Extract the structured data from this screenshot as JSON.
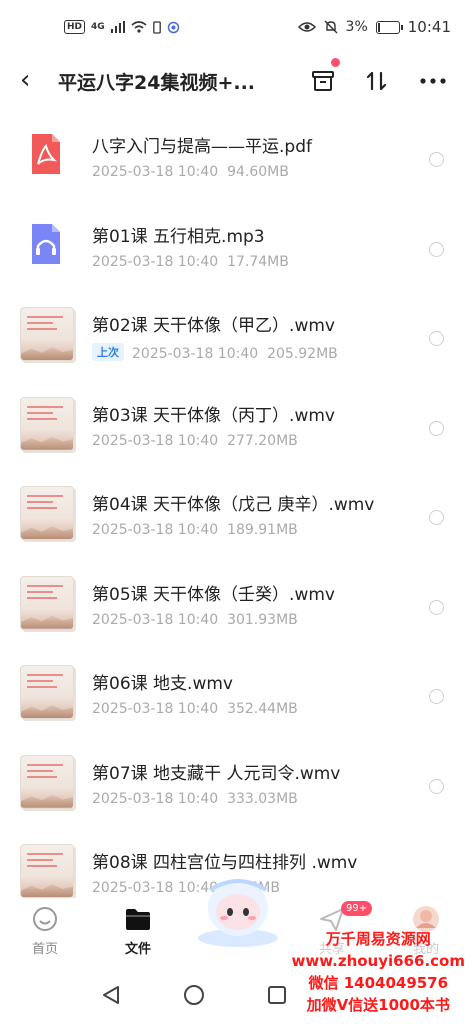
{
  "status_bar": {
    "hd": "HD",
    "network": "4G",
    "battery": "3%",
    "time": "10:41"
  },
  "header": {
    "title": "平运八字24集视频+...",
    "back_icon": "chevron-left-icon",
    "icons": [
      "archive-box-icon",
      "sort-icon",
      "more-icon"
    ]
  },
  "files": [
    {
      "name": "八字入门与提高——平运.pdf",
      "date": "2025-03-18  10:40",
      "size": "94.60MB",
      "type": "pdf",
      "badge": ""
    },
    {
      "name": "第01课  五行相克.mp3",
      "date": "2025-03-18  10:40",
      "size": "17.74MB",
      "type": "audio",
      "badge": ""
    },
    {
      "name": "第02课  天干体像（甲乙）.wmv",
      "date": "2025-03-18  10:40",
      "size": "205.92MB",
      "type": "video",
      "badge": "上次"
    },
    {
      "name": "第03课  天干体像（丙丁）.wmv",
      "date": "2025-03-18  10:40",
      "size": "277.20MB",
      "type": "video",
      "badge": ""
    },
    {
      "name": "第04课  天干体像（戊己  庚辛）.wmv",
      "date": "2025-03-18  10:40",
      "size": "189.91MB",
      "type": "video",
      "badge": ""
    },
    {
      "name": "第05课  天干体像（壬癸）.wmv",
      "date": "2025-03-18  10:40",
      "size": "301.93MB",
      "type": "video",
      "badge": ""
    },
    {
      "name": "第06课  地支.wmv",
      "date": "2025-03-18  10:40",
      "size": "352.44MB",
      "type": "video",
      "badge": ""
    },
    {
      "name": "第07课  地支藏干  人元司令.wmv",
      "date": "2025-03-18  10:40",
      "size": "333.03MB",
      "type": "video",
      "badge": ""
    },
    {
      "name": "第08课  四柱宫位与四柱排列 .wmv",
      "date": "2025-03-18  10:40",
      "size": "5.25MB",
      "type": "video",
      "badge": ""
    }
  ],
  "tabs": [
    {
      "label": "首页",
      "icon": "home-icon"
    },
    {
      "label": "文件",
      "icon": "folder-icon"
    },
    {
      "label": "共享",
      "icon": "send-icon",
      "badge": "99+"
    },
    {
      "label": "我的",
      "icon": "avatar-icon"
    }
  ],
  "watermark": {
    "line1": "万千周易资源网",
    "line2": "www.zhouyi666.com",
    "line3": "微信 1404049576",
    "line4": "加微V信送1000本书"
  },
  "colors": {
    "accent": "#2f7fe6",
    "pdf": "#f25a5a",
    "audio": "#7a86f5",
    "badge": "#ff4d6a",
    "watermark": "#ff1a1a"
  }
}
